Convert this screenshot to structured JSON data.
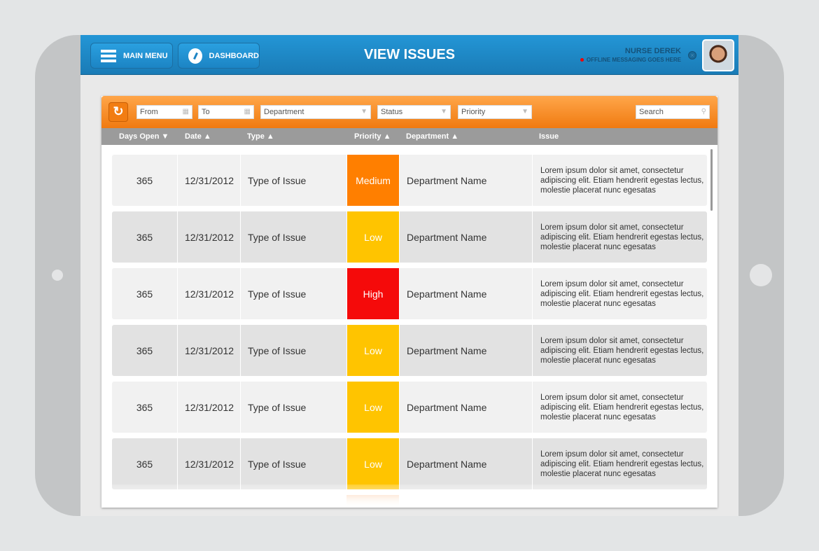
{
  "header": {
    "main_menu": "MAIN MENU",
    "dashboard": "DASHBOARD",
    "title": "VIEW ISSUES",
    "user_name": "NURSE DEREK",
    "status_message": "OFFLINE MESSAGING GOES HERE",
    "status_color": "#ee0000"
  },
  "filters": {
    "from": "From",
    "to": "To",
    "department": "Department",
    "status": "Status",
    "priority": "Priority",
    "search_placeholder": "Search"
  },
  "columns": [
    {
      "label": "Days Open",
      "sort": "desc",
      "arrow": "▼"
    },
    {
      "label": "Date",
      "sort": "asc",
      "arrow": "▲"
    },
    {
      "label": "Type",
      "sort": "asc",
      "arrow": "▲"
    },
    {
      "label": "Priority",
      "sort": "asc",
      "arrow": "▲"
    },
    {
      "label": "Department",
      "sort": "asc",
      "arrow": "▲"
    },
    {
      "label": "Issue"
    }
  ],
  "priority_colors": {
    "Medium": "#ff7f00",
    "Low": "#ffc400",
    "High": "#f50a0a"
  },
  "rows": [
    {
      "days": "365",
      "date": "12/31/2012",
      "type": "Type of Issue",
      "priority": "Medium",
      "department": "Department Name",
      "issue": "Lorem ipsum dolor sit amet, consectetur adipiscing elit. Etiam hendrerit egestas lectus, molestie placerat nunc egesatas"
    },
    {
      "days": "365",
      "date": "12/31/2012",
      "type": "Type of Issue",
      "priority": "Low",
      "department": "Department Name",
      "issue": "Lorem ipsum dolor sit amet, consectetur adipiscing elit. Etiam hendrerit egestas lectus, molestie placerat nunc egesatas"
    },
    {
      "days": "365",
      "date": "12/31/2012",
      "type": "Type of Issue",
      "priority": "High",
      "department": "Department Name",
      "issue": "Lorem ipsum dolor sit amet, consectetur adipiscing elit. Etiam hendrerit egestas lectus, molestie placerat nunc egesatas"
    },
    {
      "days": "365",
      "date": "12/31/2012",
      "type": "Type of Issue",
      "priority": "Low",
      "department": "Department Name",
      "issue": "Lorem ipsum dolor sit amet, consectetur adipiscing elit. Etiam hendrerit egestas lectus, molestie placerat nunc egesatas"
    },
    {
      "days": "365",
      "date": "12/31/2012",
      "type": "Type of Issue",
      "priority": "Low",
      "department": "Department Name",
      "issue": "Lorem ipsum dolor sit amet, consectetur adipiscing elit. Etiam hendrerit egestas lectus, molestie placerat nunc egesatas"
    },
    {
      "days": "365",
      "date": "12/31/2012",
      "type": "Type of Issue",
      "priority": "Low",
      "department": "Department Name",
      "issue": "Lorem ipsum dolor sit amet, consectetur adipiscing elit. Etiam hendrerit egestas lectus, molestie placerat nunc egesatas"
    }
  ]
}
